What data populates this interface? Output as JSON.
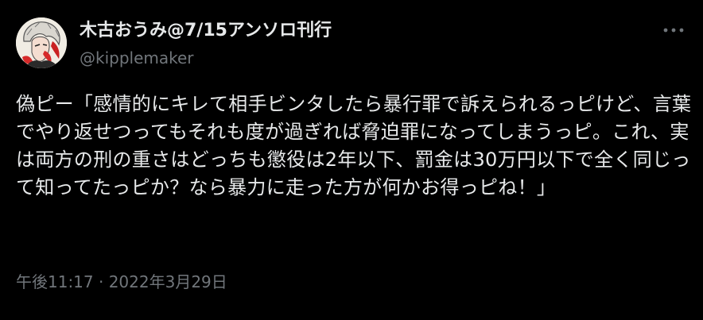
{
  "author": {
    "display_name": "木古おうみ@7/15アンソロ刊行",
    "handle": "@kipplemaker",
    "avatar_icon": "user-avatar-illustration"
  },
  "menu": {
    "icon": "more-horizontal-icon"
  },
  "tweet": {
    "text": "偽ピー「感情的にキレて相手ビンタしたら暴行罪で訴えられるっピけど、言葉でやり返せつってもそれも度が過ぎれば脅迫罪になってしまうっピ。これ、実は両方の刑の重さはどっちも懲役は2年以下、罰金は30万円以下で全く同じって知ってたっピか？なら暴力に走った方が何かお得っピね！」",
    "timestamp": "午後11:17 · 2022年3月29日"
  },
  "colors": {
    "background": "#000000",
    "primary_text": "#e7e9ea",
    "secondary_text": "#71767b"
  }
}
